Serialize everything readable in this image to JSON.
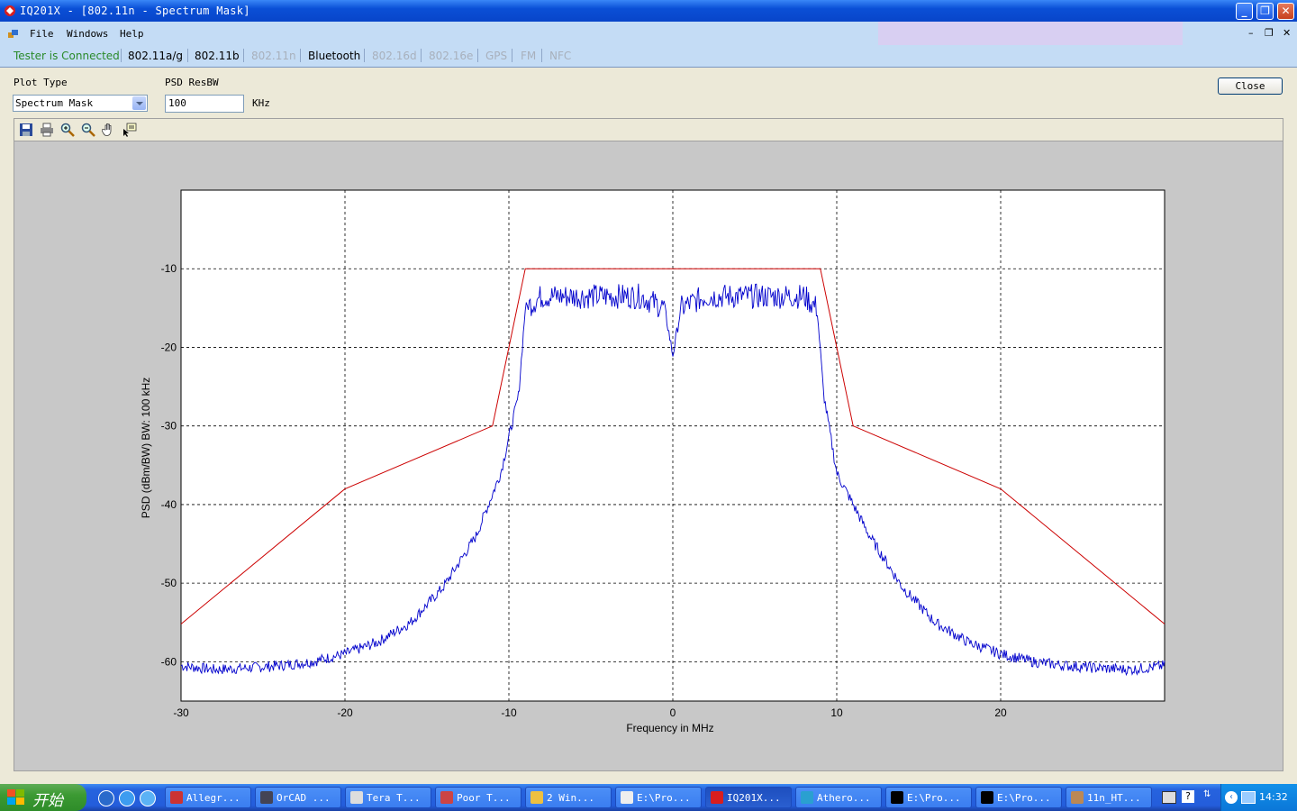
{
  "window": {
    "title": "IQ201X - [802.11n - Spectrum Mask]"
  },
  "menu": {
    "file": "File",
    "windows": "Windows",
    "help": "Help"
  },
  "tabs": {
    "status": "Tester is Connected",
    "items": [
      {
        "label": "802.11a/g",
        "enabled": true
      },
      {
        "label": "802.11b",
        "enabled": true
      },
      {
        "label": "802.11n",
        "enabled": false
      },
      {
        "label": "Bluetooth",
        "enabled": true
      },
      {
        "label": "802.16d",
        "enabled": false
      },
      {
        "label": "802.16e",
        "enabled": false
      },
      {
        "label": "GPS",
        "enabled": false
      },
      {
        "label": "FM",
        "enabled": false
      },
      {
        "label": "NFC",
        "enabled": false
      }
    ]
  },
  "controls": {
    "plot_type_label": "Plot Type",
    "plot_type_value": "Spectrum Mask",
    "psd_resbw_label": "PSD ResBW",
    "psd_resbw_value": "100",
    "psd_unit": "KHz",
    "close_label": "Close"
  },
  "toolbar_icons": [
    "save-icon",
    "print-icon",
    "zoom-in-icon",
    "zoom-out-icon",
    "pan-hand-icon",
    "data-cursor-icon"
  ],
  "chart_data": {
    "type": "line",
    "title": "",
    "xlabel": "Frequency in MHz",
    "ylabel": "PSD (dBm/BW) BW: 100 kHz",
    "xlim": [
      -30,
      30
    ],
    "ylim": [
      -65,
      0
    ],
    "xticks": [
      -30,
      -20,
      -10,
      0,
      10,
      20
    ],
    "yticks": [
      -10,
      -20,
      -30,
      -40,
      -50,
      -60
    ],
    "grid": true,
    "series": [
      {
        "color": "#cc0000",
        "x": [
          -30,
          -20,
          -11,
          -9,
          9,
          11,
          20,
          30
        ],
        "y": [
          -55.2,
          -38,
          -30,
          -10,
          -10,
          -30,
          -38,
          -55.2
        ]
      },
      {
        "color": "#0000cc",
        "x": [
          -30,
          -28,
          -26,
          -24,
          -22,
          -20,
          -18,
          -16,
          -14,
          -12,
          -10.5,
          -9.4,
          -9,
          -8,
          -6,
          -4,
          -2,
          -0.5,
          0,
          0.5,
          2,
          4,
          6,
          8,
          8.8,
          9.2,
          10,
          12,
          14,
          16,
          18,
          20,
          22,
          24,
          26,
          28,
          30
        ],
        "y": [
          -60.5,
          -61,
          -60.8,
          -60.5,
          -60,
          -59,
          -57.5,
          -55,
          -50.5,
          -44,
          -36,
          -26,
          -15,
          -13.5,
          -13.5,
          -13.5,
          -13.5,
          -15,
          -21,
          -15,
          -13.5,
          -13.5,
          -13.5,
          -13.5,
          -15,
          -26,
          -36,
          -44,
          -50.5,
          -55,
          -57.5,
          -59,
          -60,
          -60.5,
          -60.8,
          -61,
          -60.5
        ]
      }
    ]
  },
  "taskbar": {
    "start": "开始",
    "items": [
      "Allegr...",
      "OrCAD ...",
      "Tera T...",
      "Poor T...",
      "2 Win...",
      "E:\\Pro...",
      "IQ201X...",
      "Athero...",
      "E:\\Pro...",
      "E:\\Pro...",
      "11n_HT..."
    ],
    "clock": "14:32"
  }
}
